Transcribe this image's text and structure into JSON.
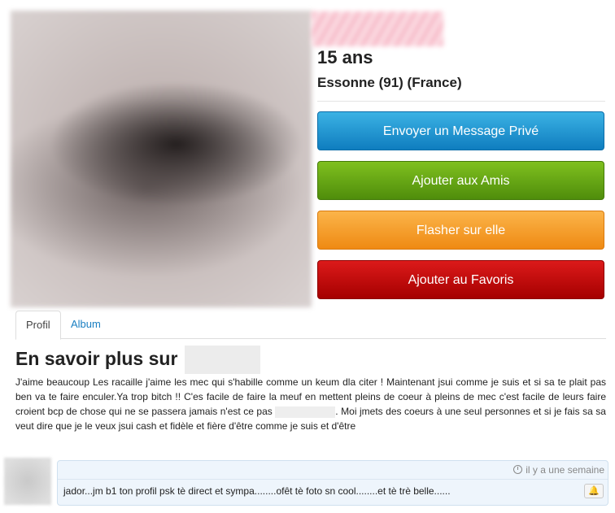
{
  "profile": {
    "age": "15 ans",
    "location": "Essonne (91) (France)"
  },
  "actions": {
    "message": "Envoyer un Message Privé",
    "friends": "Ajouter aux Amis",
    "flash": "Flasher sur elle",
    "favorites": "Ajouter au Favoris"
  },
  "tabs": [
    {
      "label": "Profil",
      "active": true
    },
    {
      "label": "Album",
      "active": false
    }
  ],
  "about": {
    "title": "En savoir plus sur",
    "text_before": "J'aime beaucoup Les racaille j'aime les mec qui s'habille comme un keum dla citer ! Maintenant jsui comme je suis et si sa te plait pas ben va te faire enculer.Ya trop bitch !! C'es facile de faire la meuf en mettent pleins de coeur à pleins de mec c'est facile de leurs faire croient bcp de chose qui ne se passera jamais n'est ce pas",
    "text_after": ". Moi jmets des coeurs à une seul personnes et si je fais sa sa veut dire que je le veux jsui cash et fidèle et fière d'être comme je suis et d'être"
  },
  "comment": {
    "time": "il y a une semaine",
    "text": "jador...jm b1 ton profil psk tè direct et sympa........ofêt tè foto sn cool........et tè trè belle......",
    "alert_icon": "bell-icon"
  },
  "colors": {
    "message": "#1a8fd0",
    "friends": "#66a615",
    "flash": "#f59e2b",
    "favorites": "#c30b0b",
    "link": "#1a7fc2"
  }
}
